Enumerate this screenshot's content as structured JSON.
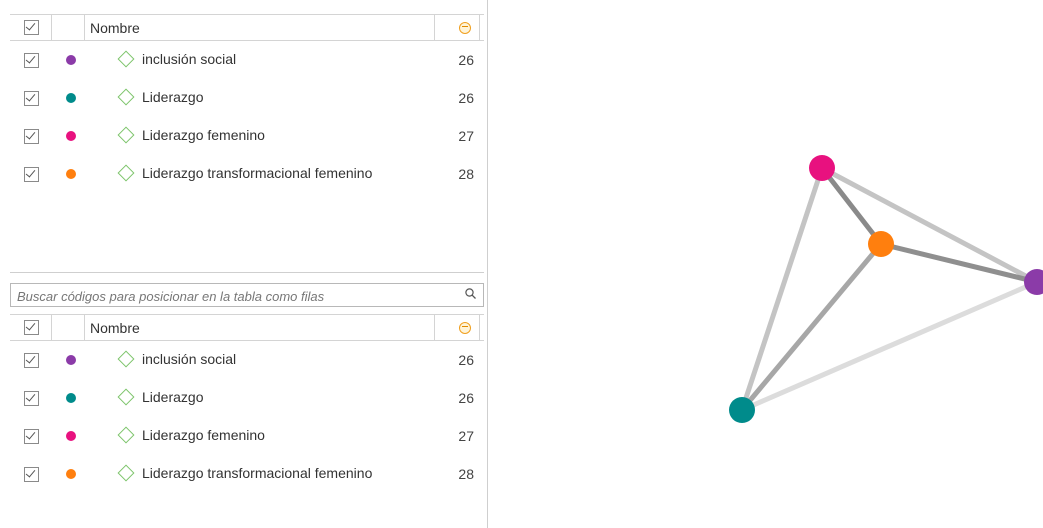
{
  "tables": {
    "top": {
      "header": {
        "name": "Nombre"
      },
      "rows": [
        {
          "label": "inclusión social",
          "count": "26",
          "color": "#8b3ba8"
        },
        {
          "label": "Liderazgo",
          "count": "26",
          "color": "#008b8b"
        },
        {
          "label": "Liderazgo femenino",
          "count": "27",
          "color": "#e8117f"
        },
        {
          "label": "Liderazgo transformacional femenino",
          "count": "28",
          "color": "#ff7f0e"
        }
      ]
    },
    "bottom": {
      "header": {
        "name": "Nombre"
      },
      "rows": [
        {
          "label": "inclusión social",
          "count": "26",
          "color": "#8b3ba8"
        },
        {
          "label": "Liderazgo",
          "count": "26",
          "color": "#008b8b"
        },
        {
          "label": "Liderazgo femenino",
          "count": "27",
          "color": "#e8117f"
        },
        {
          "label": "Liderazgo transformacional femenino",
          "count": "28",
          "color": "#ff7f0e"
        }
      ]
    }
  },
  "search": {
    "placeholder": "Buscar códigos para posicionar en la tabla como filas"
  },
  "network": {
    "nodes": [
      {
        "id": "inclusion-social",
        "color": "#8b3ba8"
      },
      {
        "id": "liderazgo",
        "color": "#008b8b"
      },
      {
        "id": "liderazgo-femenino",
        "color": "#e8117f"
      },
      {
        "id": "liderazgo-transformacional-femenino",
        "color": "#ff7f0e"
      }
    ],
    "edge_color": "#888888"
  }
}
